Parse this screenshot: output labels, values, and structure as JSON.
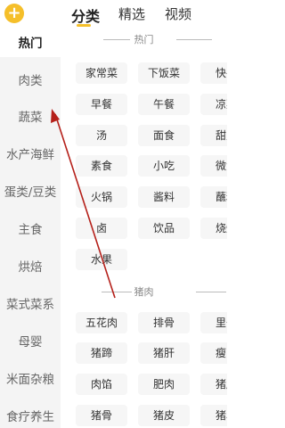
{
  "header": {
    "add_icon": "plus-icon",
    "tabs": [
      {
        "label": "分类",
        "active": true
      },
      {
        "label": "精选",
        "active": false
      },
      {
        "label": "视频",
        "active": false
      }
    ],
    "accent_color": "#f5bf2a"
  },
  "sidebar": {
    "items": [
      {
        "label": "热门",
        "active": true
      },
      {
        "label": "肉类",
        "active": false
      },
      {
        "label": "蔬菜",
        "active": false
      },
      {
        "label": "水产海鲜",
        "active": false
      },
      {
        "label": "蛋类/豆类",
        "active": false
      },
      {
        "label": "主食",
        "active": false
      },
      {
        "label": "烘焙",
        "active": false
      },
      {
        "label": "菜式菜系",
        "active": false
      },
      {
        "label": "母婴",
        "active": false
      },
      {
        "label": "米面杂粮",
        "active": false
      },
      {
        "label": "食疗养生",
        "active": false
      }
    ]
  },
  "sections": [
    {
      "title": "热门",
      "rows": [
        [
          "家常菜",
          "下饭菜",
          "快手"
        ],
        [
          "早餐",
          "午餐",
          "凉菜"
        ],
        [
          "汤",
          "面食",
          "甜点"
        ],
        [
          "素食",
          "小吃",
          "微波"
        ],
        [
          "火锅",
          "酱料",
          "蘸料"
        ],
        [
          "卤",
          "饮品",
          "烧烤"
        ],
        [
          "水果"
        ]
      ]
    },
    {
      "title": "猪肉",
      "rows": [
        [
          "五花肉",
          "排骨",
          "里脊"
        ],
        [
          "猪蹄",
          "猪肝",
          "瘦肉"
        ],
        [
          "肉馅",
          "肥肉",
          "猪肚"
        ],
        [
          "猪骨",
          "猪皮",
          "猪心"
        ]
      ]
    }
  ]
}
